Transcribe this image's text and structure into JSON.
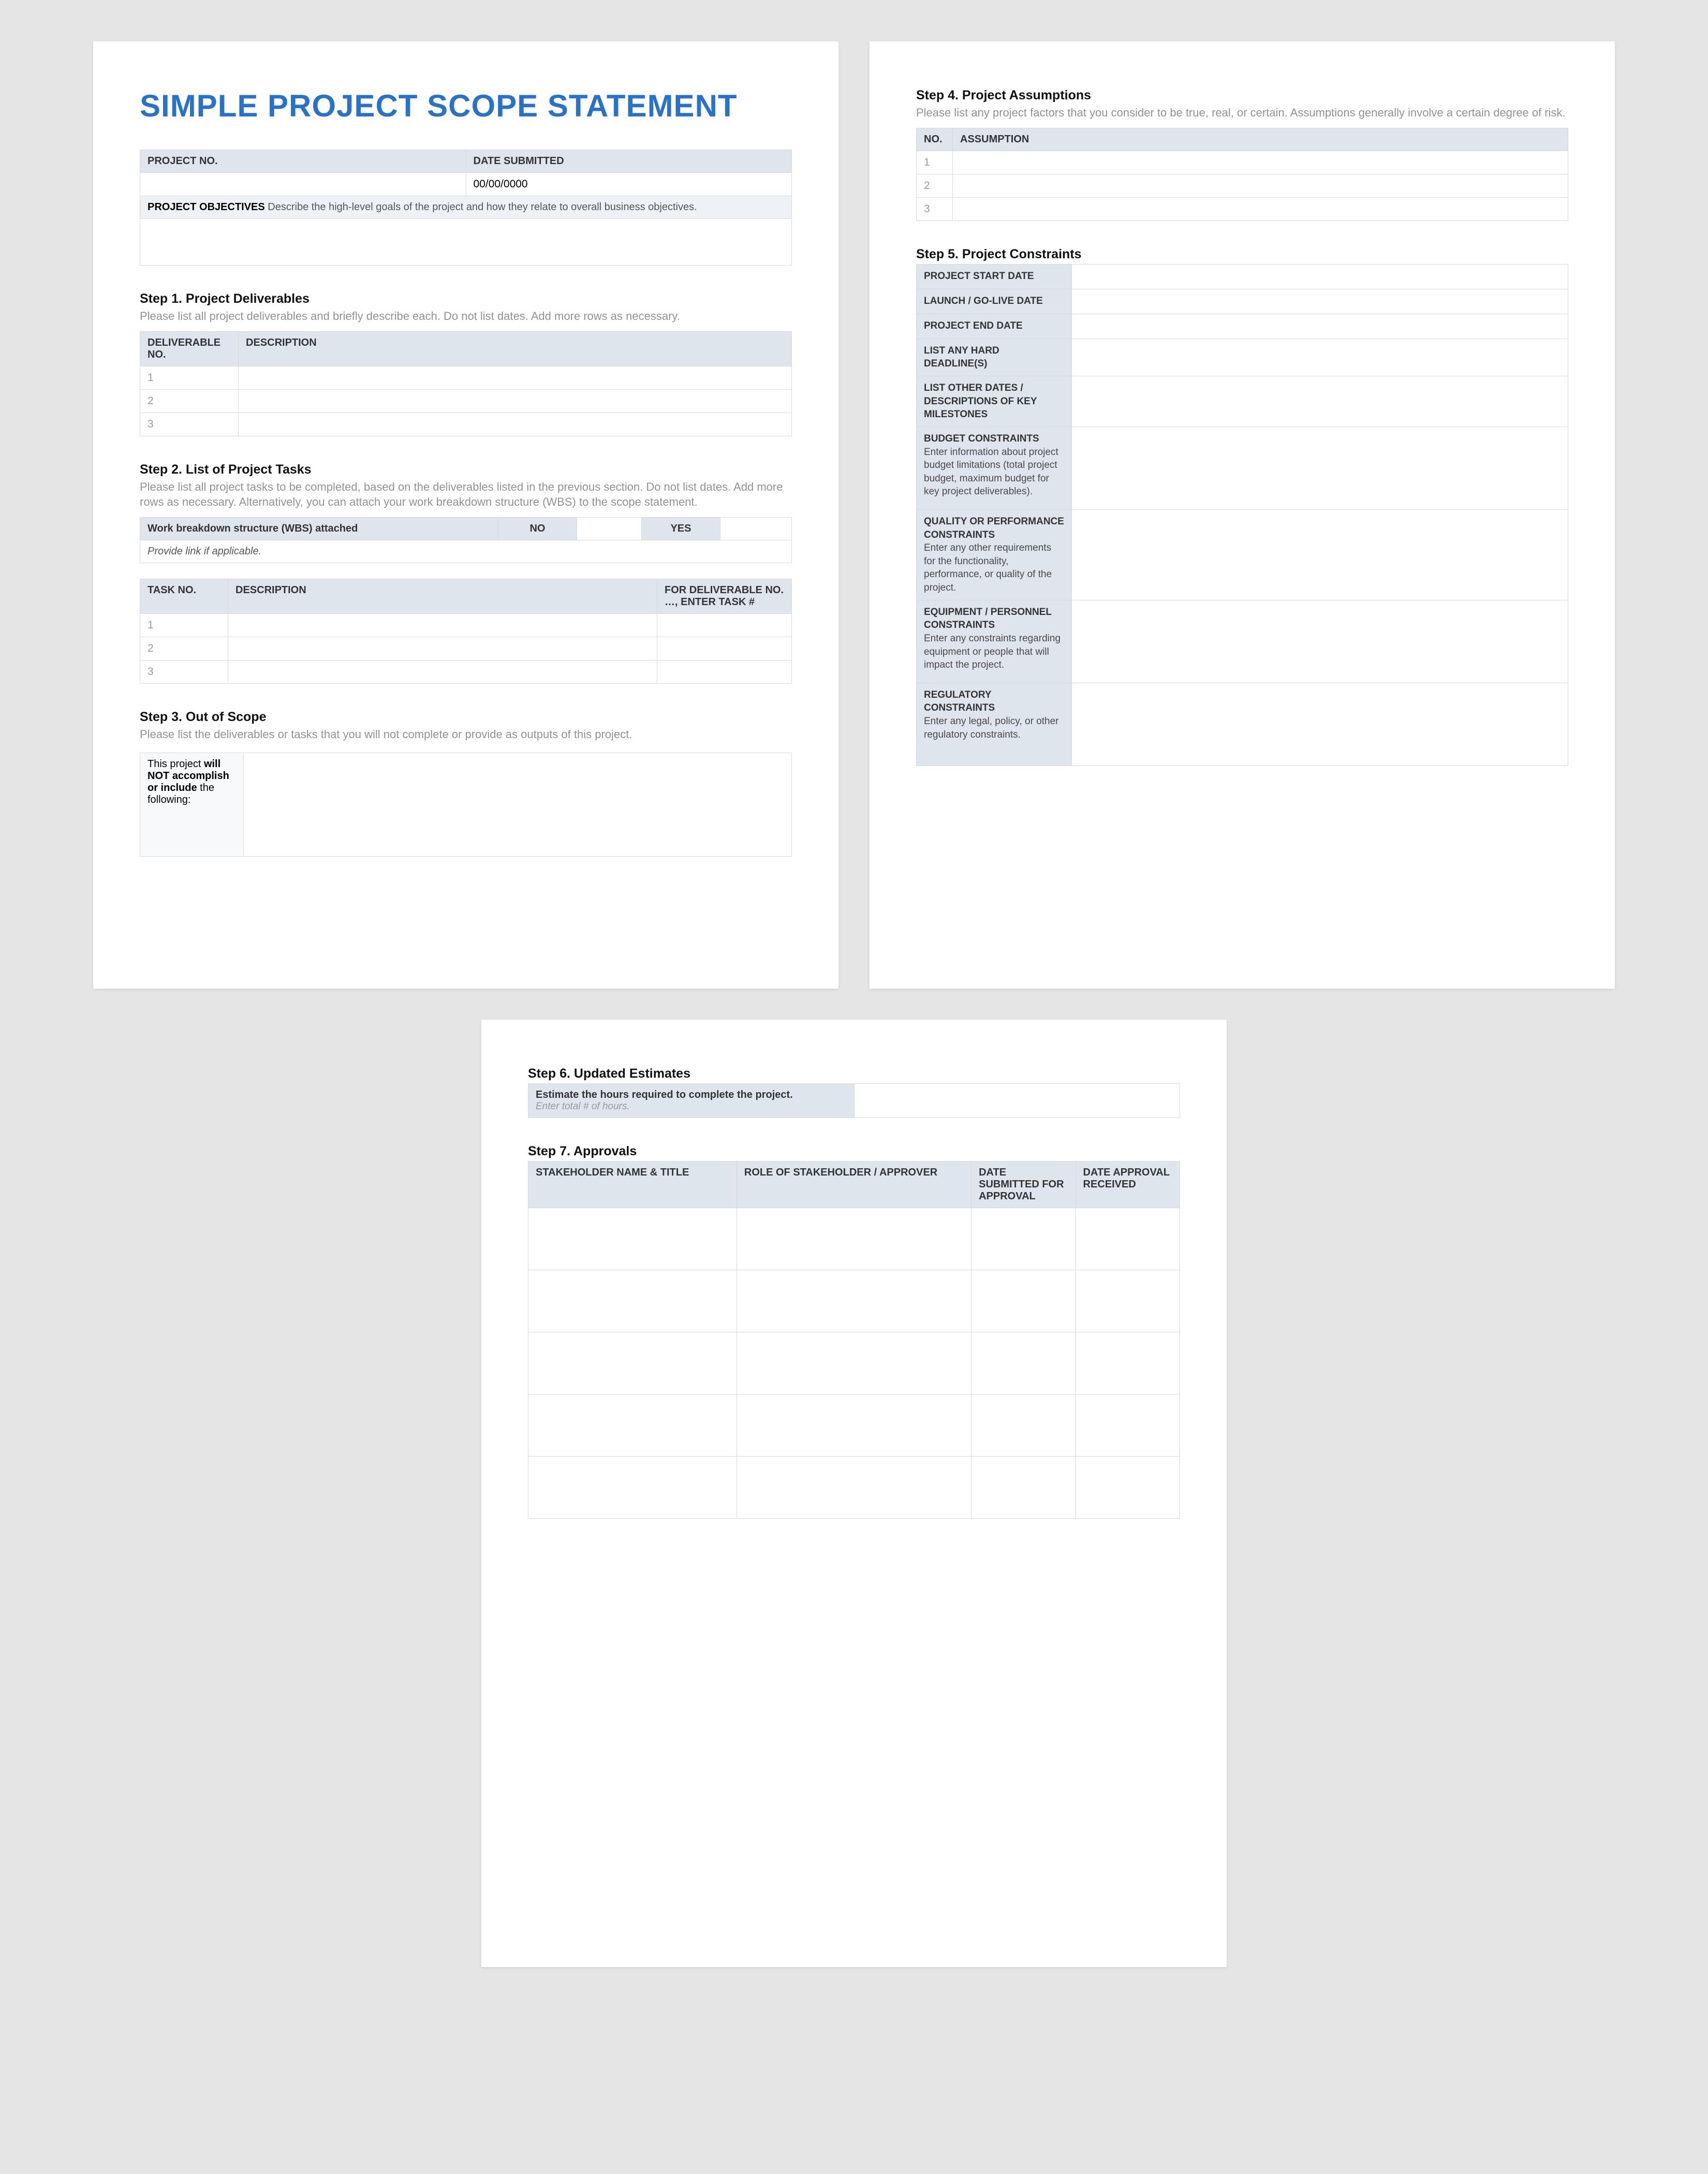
{
  "title": "SIMPLE PROJECT SCOPE STATEMENT",
  "info_table": {
    "project_no_label": "PROJECT NO.",
    "date_submitted_label": "DATE SUBMITTED",
    "project_no_value": "",
    "date_submitted_value": "00/00/0000",
    "objectives_label": "PROJECT OBJECTIVES",
    "objectives_hint": "Describe the high-level goals of the project and how they relate to overall business objectives.",
    "objectives_value": ""
  },
  "step1": {
    "title": "Step 1. Project Deliverables",
    "desc": "Please list all project deliverables and briefly describe each. Do not list dates. Add more rows as necessary.",
    "col_no": "DELIVERABLE NO.",
    "col_desc": "DESCRIPTION",
    "rows": [
      "1",
      "2",
      "3"
    ]
  },
  "step2": {
    "title": "Step 2. List of Project Tasks",
    "desc": "Please list all project tasks to be completed, based on the deliverables listed in the previous section. Do not list dates. Add more rows as necessary. Alternatively, you can attach your work breakdown structure (WBS) to the scope statement.",
    "wbs_label": "Work breakdown structure (WBS) attached",
    "no_label": "NO",
    "yes_label": "YES",
    "link_hint": "Provide link if applicable.",
    "col_taskno": "TASK NO.",
    "col_desc": "DESCRIPTION",
    "col_for": "FOR DELIVERABLE NO. …, ENTER TASK #",
    "rows": [
      "1",
      "2",
      "3"
    ]
  },
  "step3": {
    "title": "Step 3. Out of Scope",
    "desc": "Please list the deliverables or tasks that you will not complete or provide as outputs of this project.",
    "left_pre": "This project ",
    "left_bold": "will NOT accomplish or include",
    "left_post": " the following:"
  },
  "step4": {
    "title": "Step 4. Project Assumptions",
    "desc": "Please list any project factors that you consider to be true, real, or certain. Assumptions generally involve a certain degree of risk.",
    "col_no": "NO.",
    "col_assumption": "ASSUMPTION",
    "rows": [
      "1",
      "2",
      "3"
    ]
  },
  "step5": {
    "title": "Step 5. Project Constraints",
    "rows": [
      {
        "label": "PROJECT START DATE",
        "sub": ""
      },
      {
        "label": "LAUNCH / GO-LIVE DATE",
        "sub": ""
      },
      {
        "label": "PROJECT END DATE",
        "sub": ""
      },
      {
        "label": "LIST ANY HARD DEADLINE(S)",
        "sub": ""
      },
      {
        "label": "LIST OTHER DATES / DESCRIPTIONS OF KEY MILESTONES",
        "sub": ""
      },
      {
        "label": "BUDGET CONSTRAINTS",
        "sub": "Enter information about project budget limitations (total project budget, maximum budget for key project deliverables)."
      },
      {
        "label": "QUALITY OR PERFORMANCE CONSTRAINTS",
        "sub": "Enter any other requirements for the functionality, performance, or quality of the project."
      },
      {
        "label": "EQUIPMENT / PERSONNEL CONSTRAINTS",
        "sub": "Enter any constraints regarding equipment or people that will impact the project."
      },
      {
        "label": "REGULATORY CONSTRAINTS",
        "sub": "Enter any legal, policy, or other regulatory constraints."
      }
    ]
  },
  "step6": {
    "title": "Step 6. Updated Estimates",
    "label": "Estimate the hours required to complete the project.",
    "hint": "Enter total # of hours."
  },
  "step7": {
    "title": "Step 7. Approvals",
    "col_name": "STAKEHOLDER NAME & TITLE",
    "col_role": "ROLE OF STAKEHOLDER / APPROVER",
    "col_sub": "DATE SUBMITTED FOR APPROVAL",
    "col_rec": "DATE APPROVAL RECEIVED",
    "row_count": 5
  }
}
